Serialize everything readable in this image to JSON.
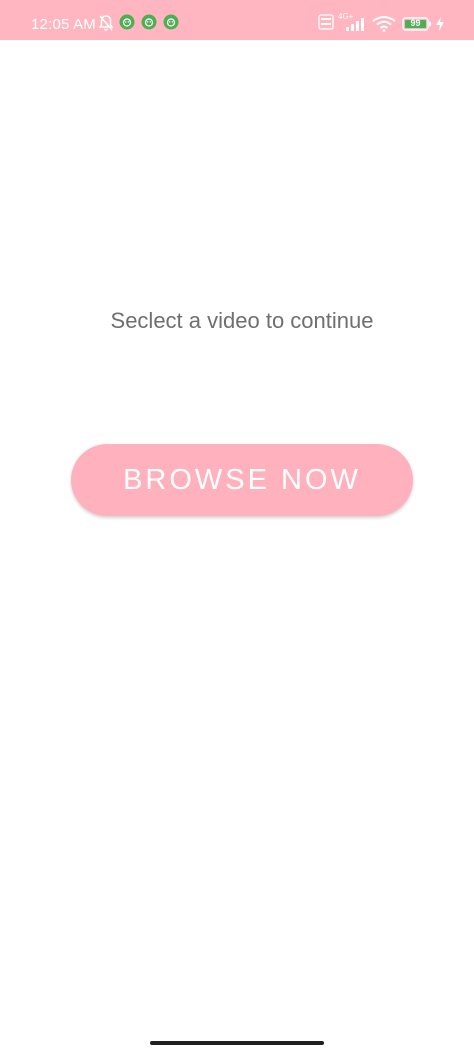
{
  "status_bar": {
    "time": "12:05 AM",
    "network_label": "4G+",
    "battery_level": "99",
    "icons": [
      "muted-bell-icon",
      "app-notification-icon",
      "app-notification-icon",
      "app-notification-icon",
      "volte-icon",
      "signal-icon",
      "wifi-icon",
      "battery-icon",
      "charging-icon"
    ],
    "background_color": "#ffb6c1"
  },
  "main": {
    "prompt": "Seclect a video to continue",
    "browse_button_label": "BROWSE NOW",
    "button_color": "#ffb1bd",
    "text_color": "#6f6f6f"
  }
}
